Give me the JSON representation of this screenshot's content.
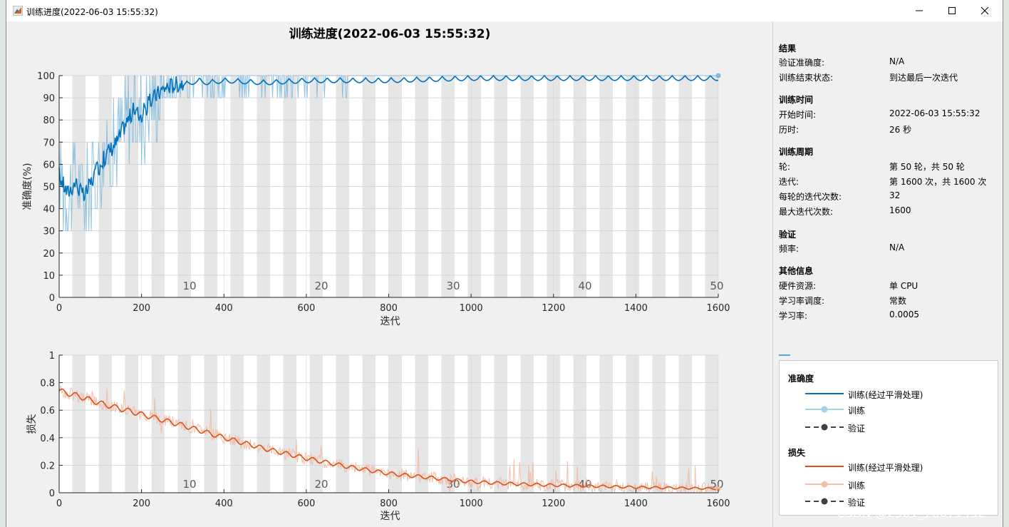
{
  "window": {
    "title": "训练进度(2022-06-03 15:55:32)"
  },
  "figure": {
    "title": "训练进度(2022-06-03 15:55:32)"
  },
  "colors": {
    "accuracy_smoothed": "#0072bd",
    "accuracy_raw": "#7fb9dd",
    "loss_smoothed": "#d95319",
    "loss_raw": "#f2b49a",
    "validation": "#404040",
    "epoch_band": "#e6e6e6"
  },
  "chart_data": [
    {
      "type": "line",
      "name": "accuracy",
      "xlabel": "迭代",
      "ylabel": "准确度(%)",
      "xlim": [
        0,
        1600
      ],
      "ylim": [
        0,
        100
      ],
      "xticks": [
        0,
        200,
        400,
        600,
        800,
        1000,
        1200,
        1400,
        1600
      ],
      "yticks": [
        0,
        10,
        20,
        30,
        40,
        50,
        60,
        70,
        80,
        90,
        100
      ],
      "epoch_labels": [
        10,
        20,
        30,
        40,
        50
      ],
      "iterations_per_epoch": 32,
      "grid": true,
      "series": [
        {
          "name": "训练(经过平滑处理)",
          "x": [
            0,
            20,
            40,
            60,
            80,
            100,
            120,
            140,
            160,
            180,
            200,
            220,
            240,
            260,
            280,
            300,
            320,
            340,
            360,
            400,
            500,
            600,
            700,
            800,
            1000,
            1200,
            1400,
            1600
          ],
          "values": [
            55,
            47,
            52,
            45,
            53,
            60,
            66,
            70,
            78,
            84,
            82,
            88,
            92,
            95,
            96,
            97,
            98,
            99,
            98,
            99,
            98,
            99,
            99,
            99,
            100,
            100,
            100,
            100
          ]
        },
        {
          "name": "训练",
          "x": [
            0,
            20,
            40,
            60,
            80,
            100,
            120,
            140,
            160,
            180,
            200,
            220,
            240,
            260,
            280,
            300,
            320,
            340,
            360,
            400,
            500,
            600,
            700,
            800,
            1000,
            1200,
            1400,
            1600
          ],
          "values": [
            50,
            10,
            70,
            40,
            60,
            50,
            90,
            40,
            80,
            90,
            70,
            100,
            80,
            90,
            100,
            90,
            100,
            100,
            90,
            100,
            90,
            100,
            100,
            100,
            100,
            100,
            100,
            100
          ]
        }
      ]
    },
    {
      "type": "line",
      "name": "loss",
      "xlabel": "迭代",
      "ylabel": "损失",
      "xlim": [
        0,
        1600
      ],
      "ylim": [
        0,
        1
      ],
      "xticks": [
        0,
        200,
        400,
        600,
        800,
        1000,
        1200,
        1400,
        1600
      ],
      "yticks": [
        0,
        0.2,
        0.4,
        0.6,
        0.8,
        1
      ],
      "yticklabels": [
        "0",
        "0.2",
        "0.4",
        "0.6",
        "0.8",
        "1"
      ],
      "epoch_labels": [
        10,
        20,
        30,
        40,
        50
      ],
      "grid": true,
      "series": [
        {
          "name": "训练(经过平滑处理)",
          "x": [
            0,
            50,
            100,
            200,
            300,
            400,
            500,
            600,
            700,
            800,
            900,
            1000,
            1100,
            1200,
            1300,
            1400,
            1500,
            1600
          ],
          "values": [
            0.74,
            0.7,
            0.65,
            0.57,
            0.49,
            0.4,
            0.32,
            0.25,
            0.19,
            0.14,
            0.11,
            0.08,
            0.065,
            0.055,
            0.048,
            0.04,
            0.035,
            0.03
          ]
        },
        {
          "name": "训练",
          "x": [
            0,
            50,
            100,
            200,
            300,
            400,
            500,
            600,
            700,
            800,
            900,
            1000,
            1100,
            1200,
            1300,
            1400,
            1500,
            1600
          ],
          "values": [
            0.78,
            0.66,
            0.7,
            0.54,
            0.52,
            0.37,
            0.34,
            0.22,
            0.21,
            0.12,
            0.12,
            0.07,
            0.07,
            0.05,
            0.05,
            0.04,
            0.03,
            0.03
          ]
        }
      ]
    }
  ],
  "panel": {
    "result": {
      "title": "结果",
      "val_acc_label": "验证准确度:",
      "val_acc_value": "N/A",
      "status_label": "训练结束状态:",
      "status_value": "到达最后一次迭代"
    },
    "time": {
      "title": "训练时间",
      "start_label": "开始时间:",
      "start_value": "2022-06-03 15:55:32",
      "elapsed_label": "历时:",
      "elapsed_value": "26 秒"
    },
    "cycle": {
      "title": "训练周期",
      "epoch_label": "轮:",
      "epoch_value": "第 50 轮，共 50 轮",
      "iter_label": "迭代:",
      "iter_value": "第 1600 次，共 1600 次",
      "per_epoch_label": "每轮的迭代次数:",
      "per_epoch_value": "32",
      "max_iter_label": "最大迭代次数:",
      "max_iter_value": "1600"
    },
    "validation": {
      "title": "验证",
      "freq_label": "频率:",
      "freq_value": "N/A"
    },
    "other": {
      "title": "其他信息",
      "hw_label": "硬件资源:",
      "hw_value": "单 CPU",
      "lr_sched_label": "学习率调度:",
      "lr_sched_value": "常数",
      "lr_label": "学习率:",
      "lr_value": "0.0005"
    }
  },
  "legend": {
    "acc_head": "准确度",
    "acc_smoothed": "训练(经过平滑处理)",
    "acc_train": "训练",
    "acc_val": "验证",
    "loss_head": "损失",
    "loss_smoothed": "训练(经过平滑处理)",
    "loss_train": "训练",
    "loss_val": "验证"
  },
  "watermark": "CSDN @2301_76671452"
}
